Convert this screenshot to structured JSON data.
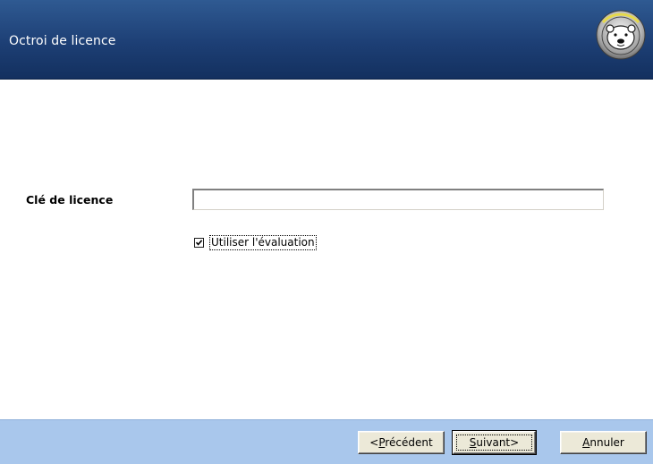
{
  "header": {
    "title": "Octroi de licence",
    "logo_icon": "polar-bear-logo-icon"
  },
  "form": {
    "license_label": "Clé de licence",
    "license_value": "",
    "license_placeholder": "",
    "evaluation_checkbox": {
      "label": "Utiliser l'évaluation",
      "checked": true
    }
  },
  "footer": {
    "buttons": {
      "previous_prefix": "<",
      "previous_mnemonic": "P",
      "previous_rest": "récédent",
      "next_mnemonic": "S",
      "next_rest": "uivant>",
      "cancel_mnemonic": "A",
      "cancel_rest": "nnuler"
    }
  },
  "colors": {
    "header_bg": "#1d3f75",
    "footer_bg": "#a9c7ec",
    "button_face": "#ece9d8"
  }
}
